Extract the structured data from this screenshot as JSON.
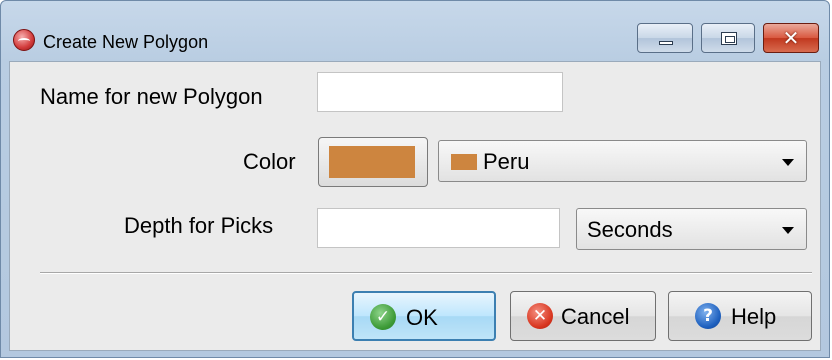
{
  "window": {
    "title": "Create New Polygon"
  },
  "form": {
    "name_label": "Name for new Polygon",
    "name_value": "",
    "color_label": "Color",
    "color_hex": "#CD853F",
    "color_selected": "Peru",
    "depth_label": "Depth for Picks",
    "depth_value": "",
    "depth_unit_selected": "Seconds"
  },
  "buttons": {
    "ok": "OK",
    "cancel": "Cancel",
    "help": "Help"
  },
  "icons": {
    "app": "polygon-app-icon",
    "ok": "check-icon",
    "cancel": "cancel-x-icon",
    "help": "help-question-icon"
  },
  "colors": {
    "ok_icon": "#3c9a36",
    "cancel_icon": "#d8351f",
    "help_icon": "#1d5fbe",
    "close_button": "#c1381f"
  }
}
